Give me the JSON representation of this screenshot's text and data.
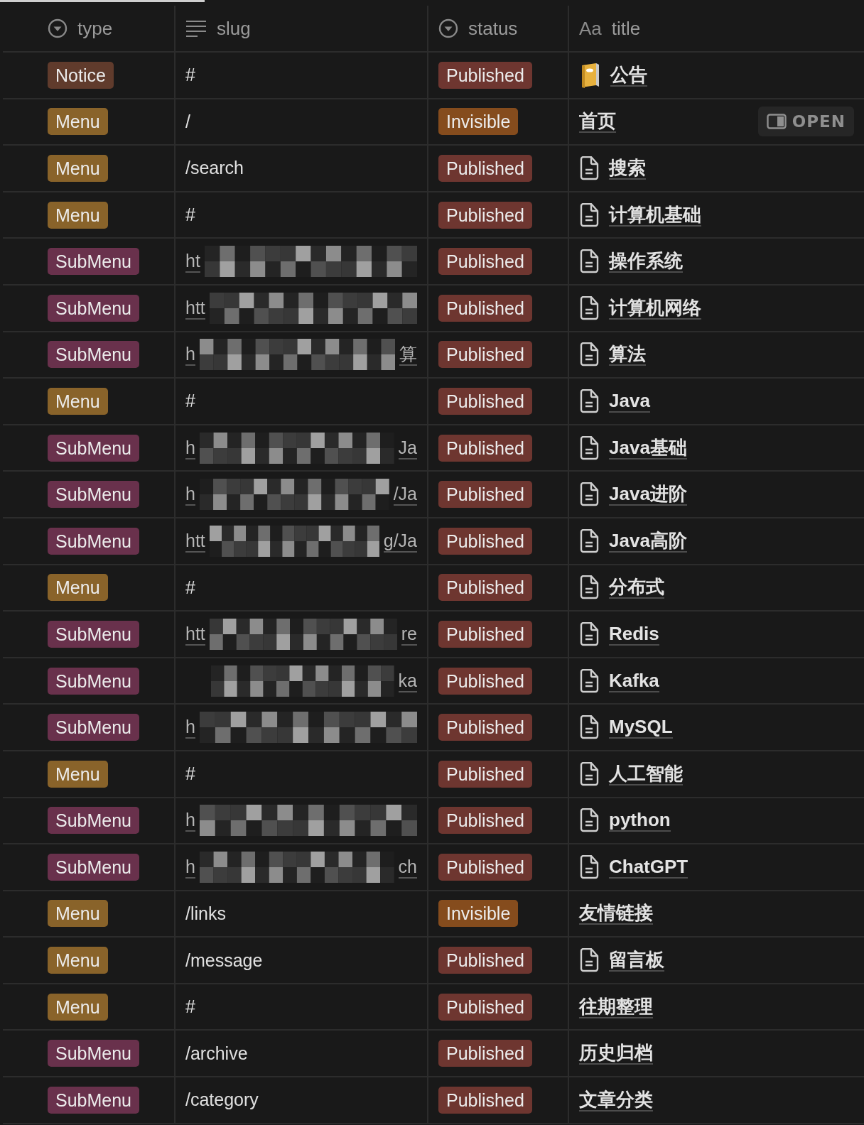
{
  "columns": [
    {
      "kind": "select",
      "label": "type"
    },
    {
      "kind": "text",
      "label": "slug"
    },
    {
      "kind": "select",
      "label": "status"
    },
    {
      "kind": "title",
      "icon_text": "Aa",
      "label": "title"
    }
  ],
  "rows": [
    {
      "type": {
        "label": "Notice",
        "color": "#603b2c"
      },
      "slug": {
        "text": "#"
      },
      "status": {
        "label": "Published",
        "color": "#6e3630"
      },
      "title": {
        "text": "公告",
        "kind": "notebook"
      }
    },
    {
      "type": {
        "label": "Menu",
        "color": "#89632a"
      },
      "slug": {
        "text": "/"
      },
      "status": {
        "label": "Invisible",
        "color": "#854c1d"
      },
      "title": {
        "text": "首页",
        "open_button": "OPEN"
      }
    },
    {
      "type": {
        "label": "Menu",
        "color": "#89632a"
      },
      "slug": {
        "text": "/search"
      },
      "status": {
        "label": "Published",
        "color": "#6e3630"
      },
      "title": {
        "text": "搜索",
        "kind": "page"
      }
    },
    {
      "type": {
        "label": "Menu",
        "color": "#89632a"
      },
      "slug": {
        "text": "#"
      },
      "status": {
        "label": "Published",
        "color": "#6e3630"
      },
      "title": {
        "text": "计算机基础",
        "kind": "page"
      }
    },
    {
      "type": {
        "label": "SubMenu",
        "color": "#69314c"
      },
      "slug": {
        "prefix": "ht",
        "redacted": true
      },
      "status": {
        "label": "Published",
        "color": "#6e3630"
      },
      "title": {
        "text": "操作系统",
        "kind": "page"
      }
    },
    {
      "type": {
        "label": "SubMenu",
        "color": "#69314c"
      },
      "slug": {
        "prefix": "htt",
        "redacted": true
      },
      "status": {
        "label": "Published",
        "color": "#6e3630"
      },
      "title": {
        "text": "计算机网络",
        "kind": "page"
      }
    },
    {
      "type": {
        "label": "SubMenu",
        "color": "#69314c"
      },
      "slug": {
        "prefix": "h",
        "suffix": "算",
        "redacted": true
      },
      "status": {
        "label": "Published",
        "color": "#6e3630"
      },
      "title": {
        "text": "算法",
        "kind": "page"
      }
    },
    {
      "type": {
        "label": "Menu",
        "color": "#89632a"
      },
      "slug": {
        "text": "#"
      },
      "status": {
        "label": "Published",
        "color": "#6e3630"
      },
      "title": {
        "text": "Java",
        "kind": "page"
      }
    },
    {
      "type": {
        "label": "SubMenu",
        "color": "#69314c"
      },
      "slug": {
        "prefix": "h",
        "suffix": "Ja",
        "redacted": true
      },
      "status": {
        "label": "Published",
        "color": "#6e3630"
      },
      "title": {
        "text": "Java基础",
        "kind": "page"
      }
    },
    {
      "type": {
        "label": "SubMenu",
        "color": "#69314c"
      },
      "slug": {
        "prefix": "h",
        "suffix": "/Ja",
        "redacted": true
      },
      "status": {
        "label": "Published",
        "color": "#6e3630"
      },
      "title": {
        "text": "Java进阶",
        "kind": "page"
      }
    },
    {
      "type": {
        "label": "SubMenu",
        "color": "#69314c"
      },
      "slug": {
        "prefix": "htt",
        "suffix": "g/Ja",
        "redacted": true
      },
      "status": {
        "label": "Published",
        "color": "#6e3630"
      },
      "title": {
        "text": "Java高阶",
        "kind": "page"
      }
    },
    {
      "type": {
        "label": "Menu",
        "color": "#89632a"
      },
      "slug": {
        "text": "#"
      },
      "status": {
        "label": "Published",
        "color": "#6e3630"
      },
      "title": {
        "text": "分布式",
        "kind": "page"
      }
    },
    {
      "type": {
        "label": "SubMenu",
        "color": "#69314c"
      },
      "slug": {
        "prefix": "htt",
        "suffix": "re",
        "redacted": true
      },
      "status": {
        "label": "Published",
        "color": "#6e3630"
      },
      "title": {
        "text": "Redis",
        "kind": "page"
      }
    },
    {
      "type": {
        "label": "SubMenu",
        "color": "#69314c"
      },
      "slug": {
        "suffix": "ka",
        "redacted": true
      },
      "status": {
        "label": "Published",
        "color": "#6e3630"
      },
      "title": {
        "text": "Kafka",
        "kind": "page"
      }
    },
    {
      "type": {
        "label": "SubMenu",
        "color": "#69314c"
      },
      "slug": {
        "prefix": "h",
        "redacted": true
      },
      "status": {
        "label": "Published",
        "color": "#6e3630"
      },
      "title": {
        "text": "MySQL",
        "kind": "page"
      }
    },
    {
      "type": {
        "label": "Menu",
        "color": "#89632a"
      },
      "slug": {
        "text": "#"
      },
      "status": {
        "label": "Published",
        "color": "#6e3630"
      },
      "title": {
        "text": "人工智能",
        "kind": "page"
      }
    },
    {
      "type": {
        "label": "SubMenu",
        "color": "#69314c"
      },
      "slug": {
        "prefix": "h",
        "redacted": true
      },
      "status": {
        "label": "Published",
        "color": "#6e3630"
      },
      "title": {
        "text": "python",
        "kind": "page"
      }
    },
    {
      "type": {
        "label": "SubMenu",
        "color": "#69314c"
      },
      "slug": {
        "prefix": "h",
        "suffix": "ch",
        "redacted": true
      },
      "status": {
        "label": "Published",
        "color": "#6e3630"
      },
      "title": {
        "text": "ChatGPT",
        "kind": "page"
      }
    },
    {
      "type": {
        "label": "Menu",
        "color": "#89632a"
      },
      "slug": {
        "text": "/links"
      },
      "status": {
        "label": "Invisible",
        "color": "#854c1d"
      },
      "title": {
        "text": "友情链接"
      }
    },
    {
      "type": {
        "label": "Menu",
        "color": "#89632a"
      },
      "slug": {
        "text": "/message"
      },
      "status": {
        "label": "Published",
        "color": "#6e3630"
      },
      "title": {
        "text": "留言板",
        "kind": "page"
      }
    },
    {
      "type": {
        "label": "Menu",
        "color": "#89632a"
      },
      "slug": {
        "text": "#"
      },
      "status": {
        "label": "Published",
        "color": "#6e3630"
      },
      "title": {
        "text": "往期整理"
      }
    },
    {
      "type": {
        "label": "SubMenu",
        "color": "#69314c"
      },
      "slug": {
        "text": "/archive"
      },
      "status": {
        "label": "Published",
        "color": "#6e3630"
      },
      "title": {
        "text": "历史归档"
      }
    },
    {
      "type": {
        "label": "SubMenu",
        "color": "#69314c"
      },
      "slug": {
        "text": "/category"
      },
      "status": {
        "label": "Published",
        "color": "#6e3630"
      },
      "title": {
        "text": "文章分类"
      }
    }
  ]
}
